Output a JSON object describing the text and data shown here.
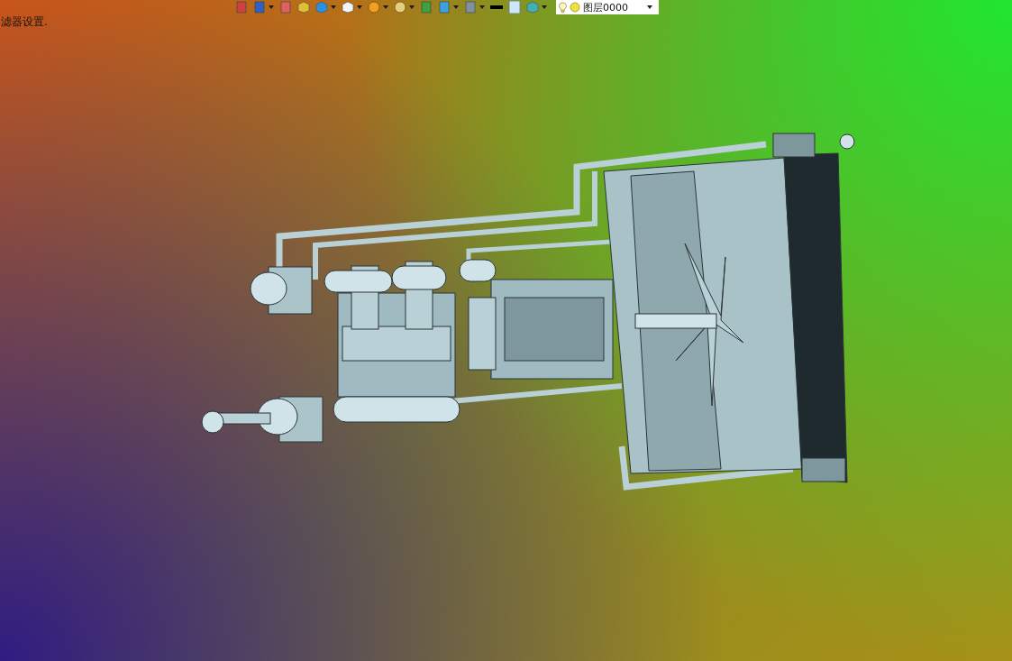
{
  "toolbar": {
    "items": [
      {
        "has_menu": false
      },
      {
        "has_menu": true
      },
      {
        "has_menu": false
      },
      {
        "has_menu": false
      },
      {
        "has_menu": true
      },
      {
        "has_menu": true
      },
      {
        "has_menu": true
      },
      {
        "has_menu": true
      },
      {
        "has_menu": false
      },
      {
        "has_menu": true
      },
      {
        "has_menu": true
      },
      {
        "has_menu": false
      },
      {
        "has_menu": false
      },
      {
        "has_menu": true
      }
    ],
    "layer_dropdown": {
      "value": "图层0000"
    }
  },
  "status_text": "滤器设置."
}
